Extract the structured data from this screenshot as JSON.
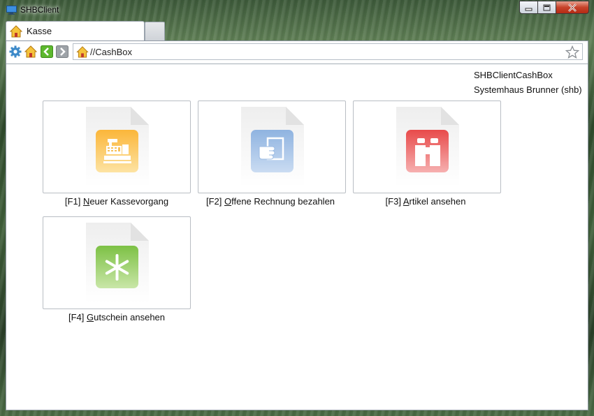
{
  "window": {
    "title": "SHBClient",
    "icon": "monitor-icon",
    "buttons": [
      "minimize-button",
      "maximize-button",
      "close-button"
    ]
  },
  "tabs": [
    {
      "label": "Kasse",
      "icon": "home-icon",
      "active": true
    }
  ],
  "toolbar": {
    "icons": [
      "gear-icon",
      "home-icon",
      "back-arrow-icon",
      "forward-arrow-icon"
    ],
    "address": "//CashBox",
    "address_icon": "home-icon",
    "bookmark_icon": "star-icon"
  },
  "info": {
    "line1": "SHBClientCashBox",
    "line2": "Systemhaus Brunner (shb)"
  },
  "tiles": [
    {
      "key": "[F1] ",
      "underlined": "N",
      "rest": "euer Kassevorgang",
      "icon": "cash-register-icon",
      "color": "#f8b73a"
    },
    {
      "key": "[F2] ",
      "underlined": "O",
      "rest": "ffene Rechnung bezahlen",
      "icon": "hand-document-icon",
      "color": "#6f9fd6"
    },
    {
      "key": "[F3] ",
      "underlined": "A",
      "rest": "rtikel ansehen",
      "icon": "binoculars-icon",
      "color": "#e24a4a"
    },
    {
      "key": "[F4] ",
      "underlined": "G",
      "rest": "utschein ansehen",
      "icon": "asterisk-icon",
      "color": "#7fc04a"
    }
  ]
}
